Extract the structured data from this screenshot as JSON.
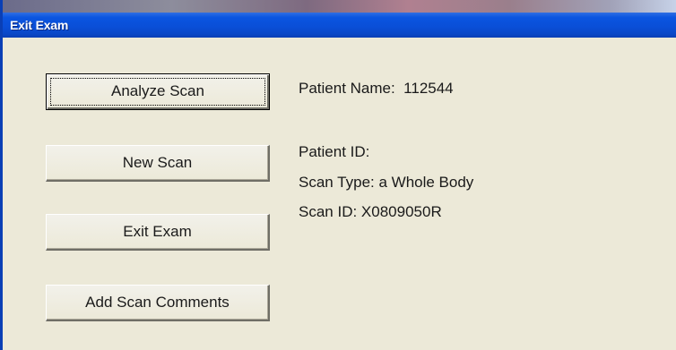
{
  "window": {
    "title": "Exit Exam"
  },
  "buttons": {
    "analyze_scan": "Analyze Scan",
    "new_scan": "New Scan",
    "exit_exam": "Exit Exam",
    "add_scan_comments": "Add Scan Comments"
  },
  "patient": {
    "name_label": "Patient Name:  112544",
    "id_label": "Patient ID:",
    "scan_type_label": "Scan Type: a Whole Body",
    "scan_id_label": "Scan ID: X0809050R"
  },
  "colors": {
    "titlebar": "#0a4fd8",
    "window_bg": "#ece9d8"
  }
}
